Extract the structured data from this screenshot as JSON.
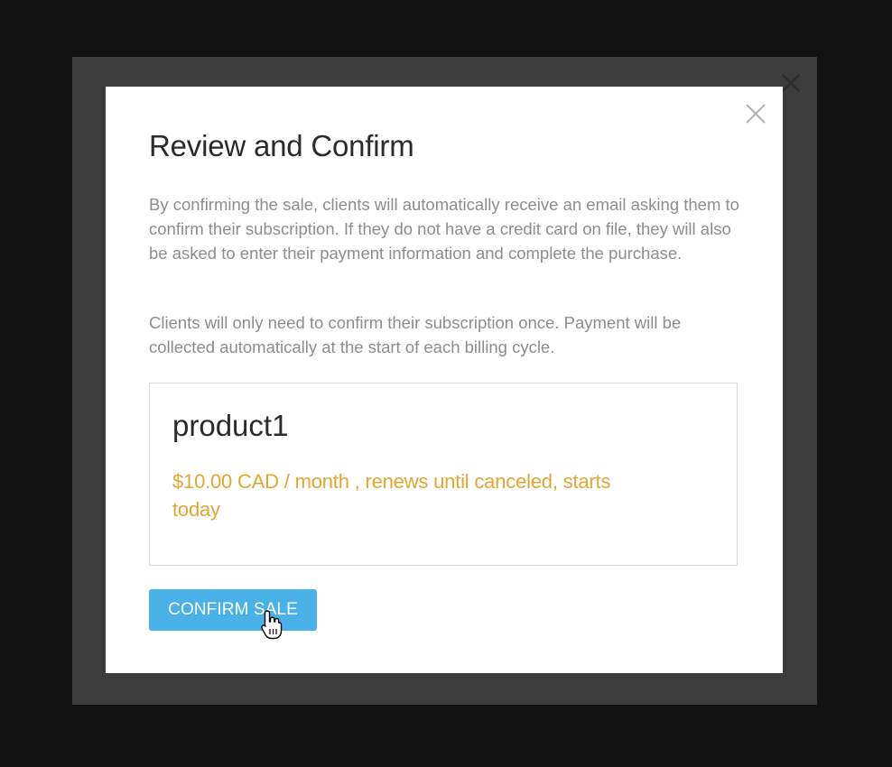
{
  "modal": {
    "title": "Review and Confirm",
    "description_1": "By confirming the sale, clients will automatically receive an email asking them to confirm their subscription. If they do not have a credit card on file, they will also be asked to enter their payment information and complete the purchase.",
    "description_2": "Clients will only need to confirm their subscription once. Payment will be collected automatically at the start of each billing cycle.",
    "close_icon": "close-icon"
  },
  "product": {
    "name": "product1",
    "terms": "$10.00 CAD / month , renews until canceled, starts today"
  },
  "actions": {
    "confirm_label": "CONFIRM SALE"
  },
  "colors": {
    "page_background": "#121212",
    "overlay_frame": "#3c3c3c",
    "accent_button": "#4ab0e8",
    "price_text": "#e3a632"
  }
}
